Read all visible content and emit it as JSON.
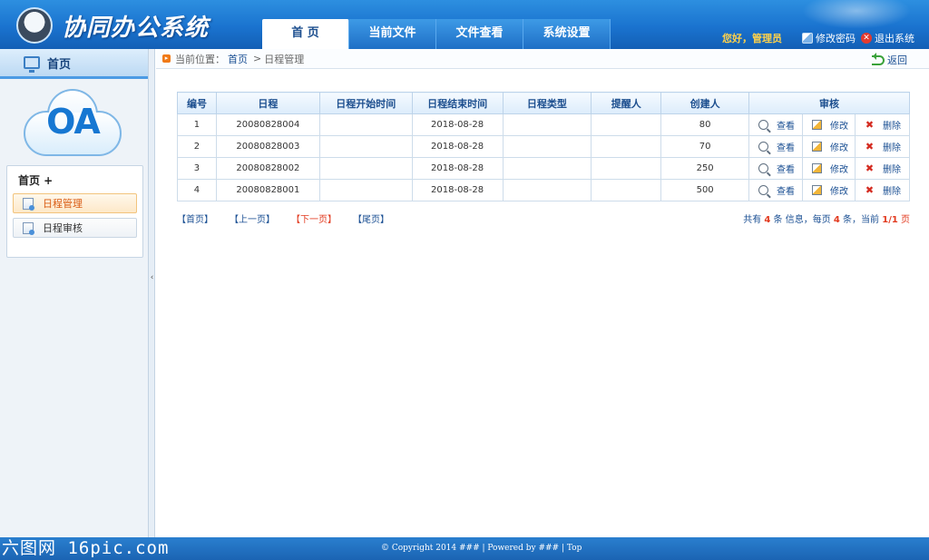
{
  "header": {
    "app_title": "协同办公系统",
    "tabs": [
      {
        "label": "首 页"
      },
      {
        "label": "当前文件"
      },
      {
        "label": "文件查看"
      },
      {
        "label": "系统设置"
      }
    ],
    "greeting": "您好，管理员",
    "change_password": "修改密码",
    "logout": "退出系统"
  },
  "sidebar": {
    "head_label": "首页",
    "logo_text": "OA",
    "menu_title": "首页  +",
    "items": [
      {
        "label": "日程管理"
      },
      {
        "label": "日程审核"
      }
    ]
  },
  "breadcrumb": {
    "prefix": "当前位置：",
    "home": "首页",
    "sep": ">",
    "current": "日程管理",
    "back": "返回"
  },
  "table": {
    "headers": [
      "编号",
      "日程",
      "日程开始时间",
      "日程结束时间",
      "日程类型",
      "提醒人",
      "创建人",
      "审核"
    ],
    "rows": [
      {
        "id": "1",
        "schedule": "20080828004",
        "start": "",
        "end": "2018-08-28",
        "type": "",
        "reminder": "",
        "creator": "80"
      },
      {
        "id": "2",
        "schedule": "20080828003",
        "start": "",
        "end": "2018-08-28",
        "type": "",
        "reminder": "",
        "creator": "70"
      },
      {
        "id": "3",
        "schedule": "20080828002",
        "start": "",
        "end": "2018-08-28",
        "type": "",
        "reminder": "",
        "creator": "250"
      },
      {
        "id": "4",
        "schedule": "20080828001",
        "start": "",
        "end": "2018-08-28",
        "type": "",
        "reminder": "",
        "creator": "500"
      }
    ],
    "actions": {
      "view": "查看",
      "edit": "修改",
      "delete": "删除"
    }
  },
  "pager": {
    "first": "【首页】",
    "prev": "【上一页】",
    "next": "【下一页】",
    "last": "【尾页】",
    "summary_a": "共有 ",
    "total": "4",
    "summary_b": " 条 信息，每页 ",
    "per_page": "4",
    "summary_c": " 条，当前 ",
    "page": "1/1",
    "summary_d": " 页"
  },
  "footer": {
    "watermark": "六图网 16pic.com",
    "copyright": "© Copyright 2014 ### | Powered by ### | Top"
  }
}
